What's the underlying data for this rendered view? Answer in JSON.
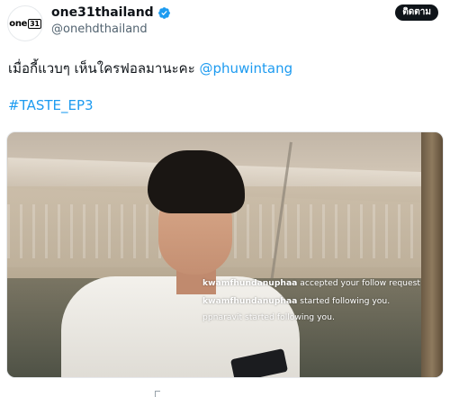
{
  "author": {
    "avatar_text": "one",
    "avatar_badge": "31",
    "display_name": "one31thailand",
    "handle": "@onehdthailand",
    "verified": true,
    "verified_color": "#1d9bf0"
  },
  "follow_button": {
    "label": "ติดตาม"
  },
  "tweet": {
    "text": "เมื่อกี้แวบๆ เห็นใครฟอลมานะคะ ",
    "mention": "@phuwintang",
    "hashtag": "#TASTE_EP3"
  },
  "media": {
    "notifications": [
      {
        "user": "kwamfhundanuphaa",
        "text": " accepted your follow request"
      },
      {
        "user": "kwamfhundanuphaa",
        "text": " started following you."
      },
      {
        "user": "",
        "text": "ppnaravit started following you."
      }
    ]
  },
  "colors": {
    "link": "#1d9bf0",
    "text": "#0f1419",
    "secondary": "#536471"
  }
}
